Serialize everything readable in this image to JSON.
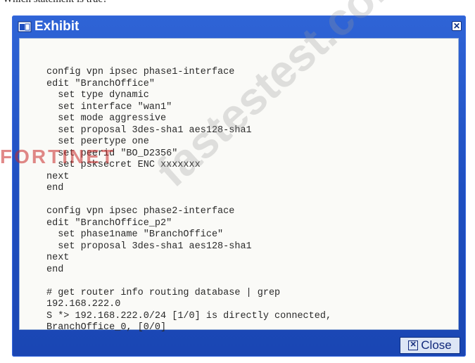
{
  "page": {
    "top_text": "Which statement is true?"
  },
  "window": {
    "title": "Exhibit",
    "title_close_glyph": "✕",
    "close_button_label": "Close",
    "close_button_glyph": "✕",
    "accent_color": "#1f4fc1"
  },
  "code_lines": [
    "config vpn ipsec phase1-interface",
    "edit \"BranchOffice\"",
    "  set type dynamic",
    "  set interface \"wan1\"",
    "  set mode aggressive",
    "  set proposal 3des-sha1 aes128-sha1",
    "  set peertype one",
    "  set peerid \"BO_D2356\"",
    "  set psksecret ENC xxxxxxx",
    "next",
    "end",
    "",
    "config vpn ipsec phase2-interface",
    "edit \"BranchOffice_p2\"",
    "  set phase1name \"BranchOffice\"",
    "  set proposal 3des-sha1 aes128-sha1",
    "next",
    "end",
    "",
    "# get router info routing database | grep",
    "192.168.222.0",
    "S *> 192.168.222.0/24 [1/0] is directly connected,",
    "BranchOffice_0, [0/0]"
  ],
  "watermarks": {
    "site": "fastestest.com",
    "brand": "FORTINET"
  }
}
